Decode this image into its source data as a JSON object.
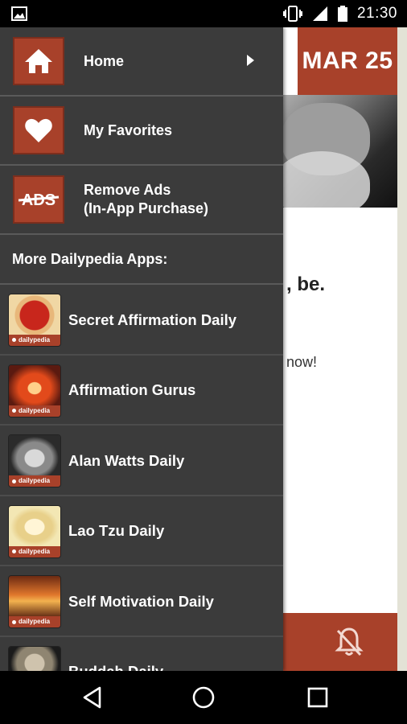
{
  "status_bar": {
    "time": "21:30"
  },
  "background": {
    "date": "MAR 25",
    "quote_fragment": ", be.",
    "now_fragment": "now!"
  },
  "drawer": {
    "menu": [
      {
        "label": "Home",
        "icon": "home-icon"
      },
      {
        "label": "My Favorites",
        "icon": "heart-icon"
      },
      {
        "label": "Remove Ads",
        "label_line2": "(In-App Purchase)",
        "icon": "ads-strikethrough-icon",
        "icon_text": "ADS"
      }
    ],
    "section_header": "More Dailypedia Apps:",
    "apps": [
      {
        "label": "Secret Affirmation Daily",
        "brand": "dailypedia"
      },
      {
        "label": "Affirmation Gurus",
        "brand": "dailypedia"
      },
      {
        "label": "Alan Watts Daily",
        "brand": "dailypedia"
      },
      {
        "label": "Lao Tzu Daily",
        "brand": "dailypedia"
      },
      {
        "label": "Self Motivation Daily",
        "brand": "dailypedia"
      },
      {
        "label": "Buddah Daily",
        "brand": ""
      }
    ]
  },
  "colors": {
    "accent": "#a8412a",
    "drawer_bg": "#3b3b3b",
    "divider": "#5a5a5a"
  }
}
